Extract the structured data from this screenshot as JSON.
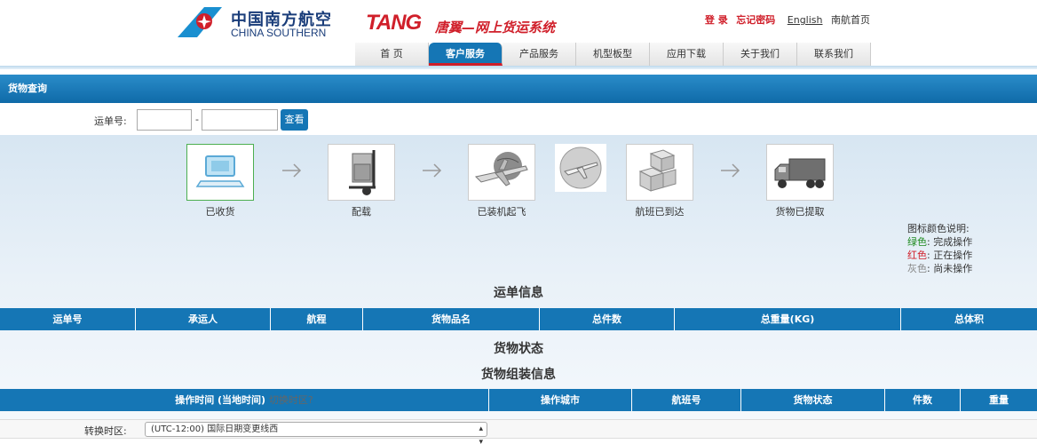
{
  "header": {
    "brand_cn": "中国南方航空",
    "brand_en": "CHINA SOUTHERN",
    "tang_logo": "TANG",
    "tang_tagline": "唐翼—网上货运系统",
    "links": {
      "login": "登 录",
      "forgot_password": "忘记密码",
      "english": "English",
      "home": "南航首页"
    }
  },
  "nav": {
    "items": [
      {
        "label": "首 页"
      },
      {
        "label": "客户服务"
      },
      {
        "label": "产品服务"
      },
      {
        "label": "机型板型"
      },
      {
        "label": "应用下载"
      },
      {
        "label": "关于我们"
      },
      {
        "label": "联系我们"
      }
    ],
    "active_index": 1
  },
  "section": {
    "title": "货物查询"
  },
  "query": {
    "label": "运单号:",
    "prefix_value": "",
    "dash": "-",
    "number_value": "",
    "button": "查看"
  },
  "stages": [
    {
      "label": "已收货",
      "icon": "laptop-icon",
      "state": "done"
    },
    {
      "label": "配载",
      "icon": "hand-truck-icon",
      "state": "pending"
    },
    {
      "label": "已装机起飞",
      "icon": "airplane-globe-icon",
      "state": "pending"
    },
    {
      "label": "",
      "icon": "airplane-in-flight-icon",
      "state": "pending"
    },
    {
      "label": "航班已到达",
      "icon": "boxes-icon",
      "state": "pending"
    },
    {
      "label": "货物已提取",
      "icon": "truck-icon",
      "state": "pending"
    }
  ],
  "legend": {
    "title": "图标颜色说明:",
    "green_label": "绿色",
    "green_text": "完成操作",
    "red_label": "红色",
    "red_text": "正在操作",
    "grey_label": "灰色",
    "grey_text": "尚未操作",
    "colon": ":"
  },
  "waybill_info": {
    "title": "运单信息",
    "columns": [
      "运单号",
      "承运人",
      "航程",
      "货物品名",
      "总件数",
      "总重量(KG)",
      "总体积"
    ]
  },
  "cargo_status": {
    "title": "货物状态"
  },
  "assembly": {
    "title": "货物组装信息",
    "columns": [
      "操作时间 (当地时间)",
      "操作城市",
      "航班号",
      "货物状态",
      "件数",
      "重量"
    ],
    "switch_tz": "切换时区?"
  },
  "timezone": {
    "label": "转换时区:",
    "selected": "(UTC-12:00) 国际日期变更线西"
  },
  "colors": {
    "primary_blue": "#1576b5",
    "brand_red": "#d01f2a",
    "done_green": "#1e8a1e"
  }
}
